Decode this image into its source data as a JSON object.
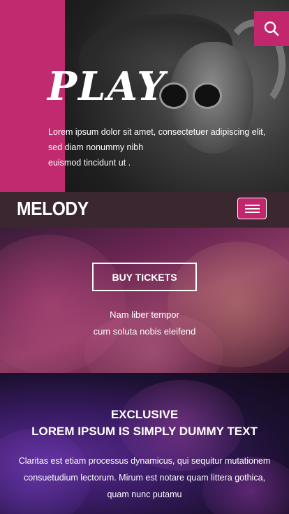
{
  "hero": {
    "title": "PLAY",
    "description_line1": "Lorem ipsum dolor sit amet, consectetuer adipiscing elit, sed diam nonummy nibh",
    "description_line2": "euismod tincidunt ut .",
    "search_icon": "search-icon",
    "accent_color": "#c2276d"
  },
  "header": {
    "brand": "MELODY",
    "menu_icon": "hamburger-menu-icon"
  },
  "tickets": {
    "button_label": "BUY TICKETS",
    "text_line1": "Nam liber tempor",
    "text_line2": "cum soluta nobis eleifend"
  },
  "exclusive": {
    "heading": "EXCLUSIVE",
    "subheading": "LOREM IPSUM IS SIMPLY DUMMY TEXT",
    "text": "Claritas est etiam processus dynamicus, qui sequitur mutationem consuetudium lectorum. Mirum est notare quam littera gothica, quam nunc putamu"
  }
}
